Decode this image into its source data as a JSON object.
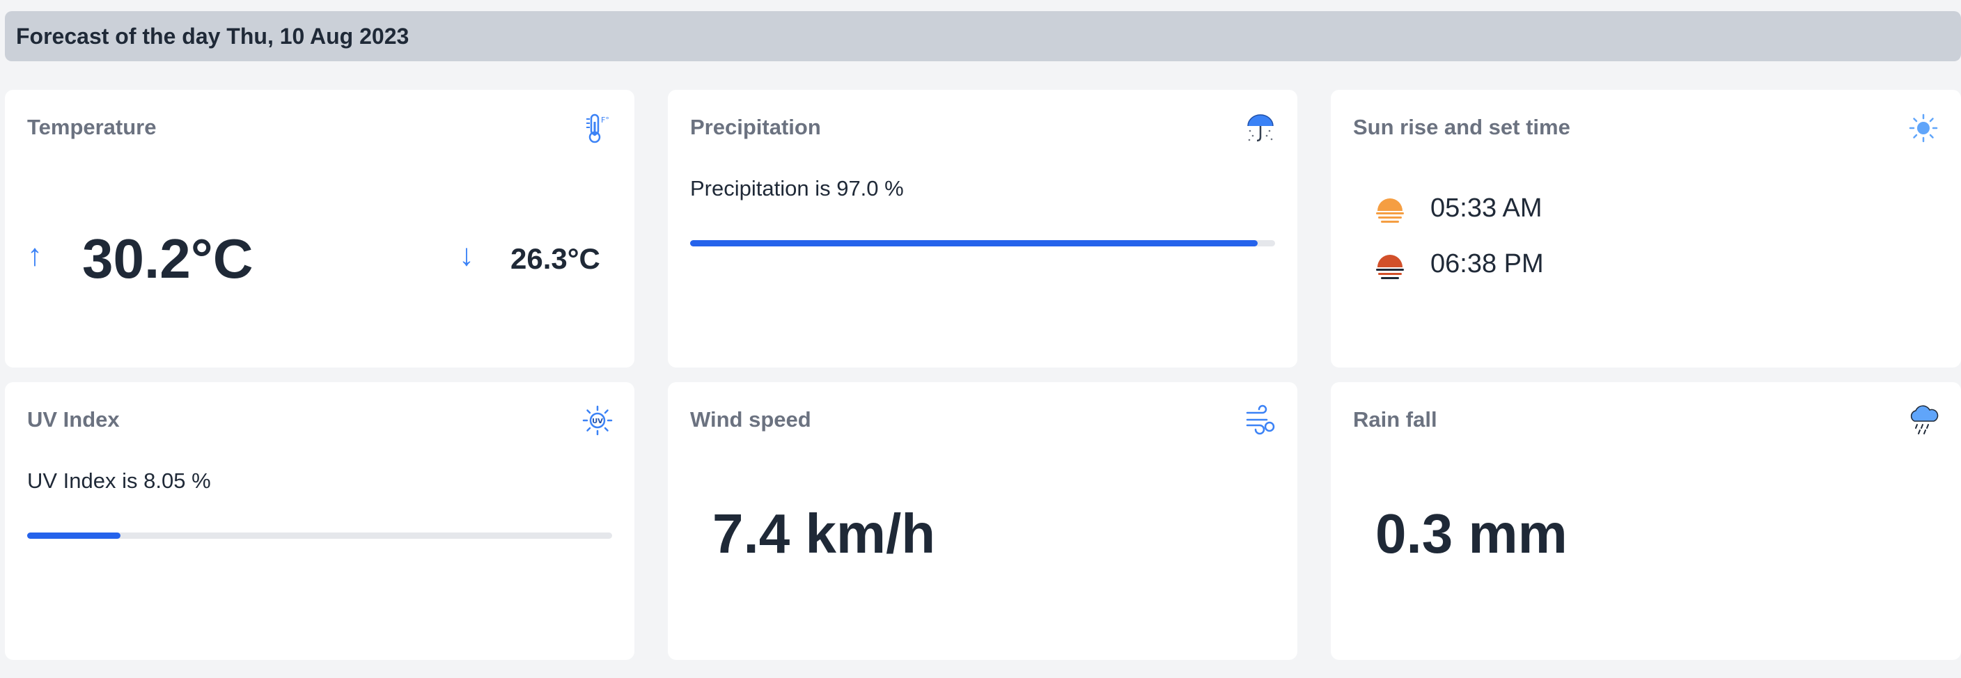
{
  "header": {
    "title": "Forecast of the day Thu, 10 Aug 2023"
  },
  "cards": {
    "temperature": {
      "title": "Temperature",
      "icon": "thermometer-icon",
      "high": "30.2°C",
      "low": "26.3°C",
      "high_arrow": "↑",
      "low_arrow": "↓"
    },
    "precipitation": {
      "title": "Precipitation",
      "icon": "umbrella-rain-icon",
      "text": "Precipitation is 97.0 %",
      "value": 97.0
    },
    "sun": {
      "title": "Sun rise and set time",
      "icon": "sun-icon",
      "sunrise": "05:33 AM",
      "sunset": "06:38 PM",
      "sunrise_icon": "sunrise-icon",
      "sunset_icon": "sunset-icon"
    },
    "uv": {
      "title": "UV Index",
      "icon": "uv-sun-icon",
      "text": "UV Index is 8.05 %",
      "value": 16
    },
    "wind": {
      "title": "Wind speed",
      "icon": "wind-icon",
      "value": "7.4 km/h"
    },
    "rain": {
      "title": "Rain fall",
      "icon": "rain-cloud-icon",
      "value": "0.3 mm"
    }
  },
  "colors": {
    "accent": "#2563eb",
    "arrow": "#3b82f6",
    "header_bg": "#cbd0d8",
    "page_bg": "#f3f4f6",
    "sunrise": "#f59e42",
    "sunset": "#d2502a"
  }
}
